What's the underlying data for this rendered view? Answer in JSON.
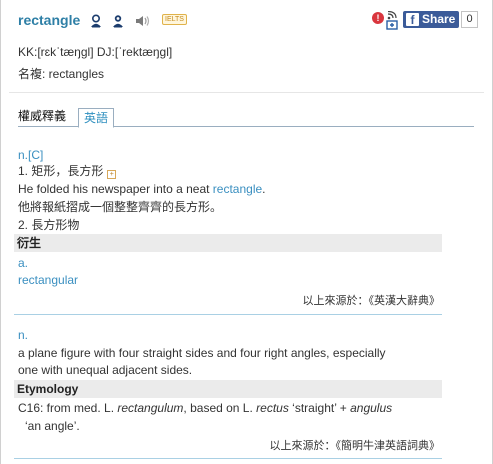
{
  "header": {
    "word": "rectangle",
    "badge": "IELTS",
    "icons": [
      "kk-pronounce-icon",
      "dj-pronounce-icon",
      "speaker-icon"
    ],
    "share_label": "Share",
    "share_count": "0"
  },
  "pronunciation": "KK:[rɛkˈtæŋgl] DJ:[ˈrektæŋgl]",
  "plural": "名複: rectangles",
  "tabs": [
    {
      "label": "權威釋義",
      "active": false
    },
    {
      "label": "英語",
      "active": true
    }
  ],
  "section1": {
    "pos": "n.[C]",
    "sense1": "1. 矩形，長方形",
    "example_pre": "He folded his newspaper into a neat ",
    "example_link": "rectangle",
    "example_post": ".",
    "translation": "他將報紙摺成一個整整齊齊的長方形。",
    "sense2": "2. 長方形物",
    "derived_header": "衍生",
    "derived_pos": "a.",
    "derived_word": "rectangular",
    "source": "以上來源於：《英漢大辭典》"
  },
  "section2": {
    "pos": "n.",
    "definition_line1": "a plane figure with four straight sides and four right angles, especially",
    "definition_line2": "one with unequal adjacent sides.",
    "etym_header": "Etymology",
    "etym_a": "C16: from med. L. ",
    "etym_b": "rectangulum",
    "etym_c": ", based on L. ",
    "etym_d": "rectus",
    "etym_e": " ‘straight’ + ",
    "etym_f": "angulus",
    "etym_line2": "‘an angle’.",
    "source": "以上來源於：《簡明牛津英語詞典》"
  }
}
